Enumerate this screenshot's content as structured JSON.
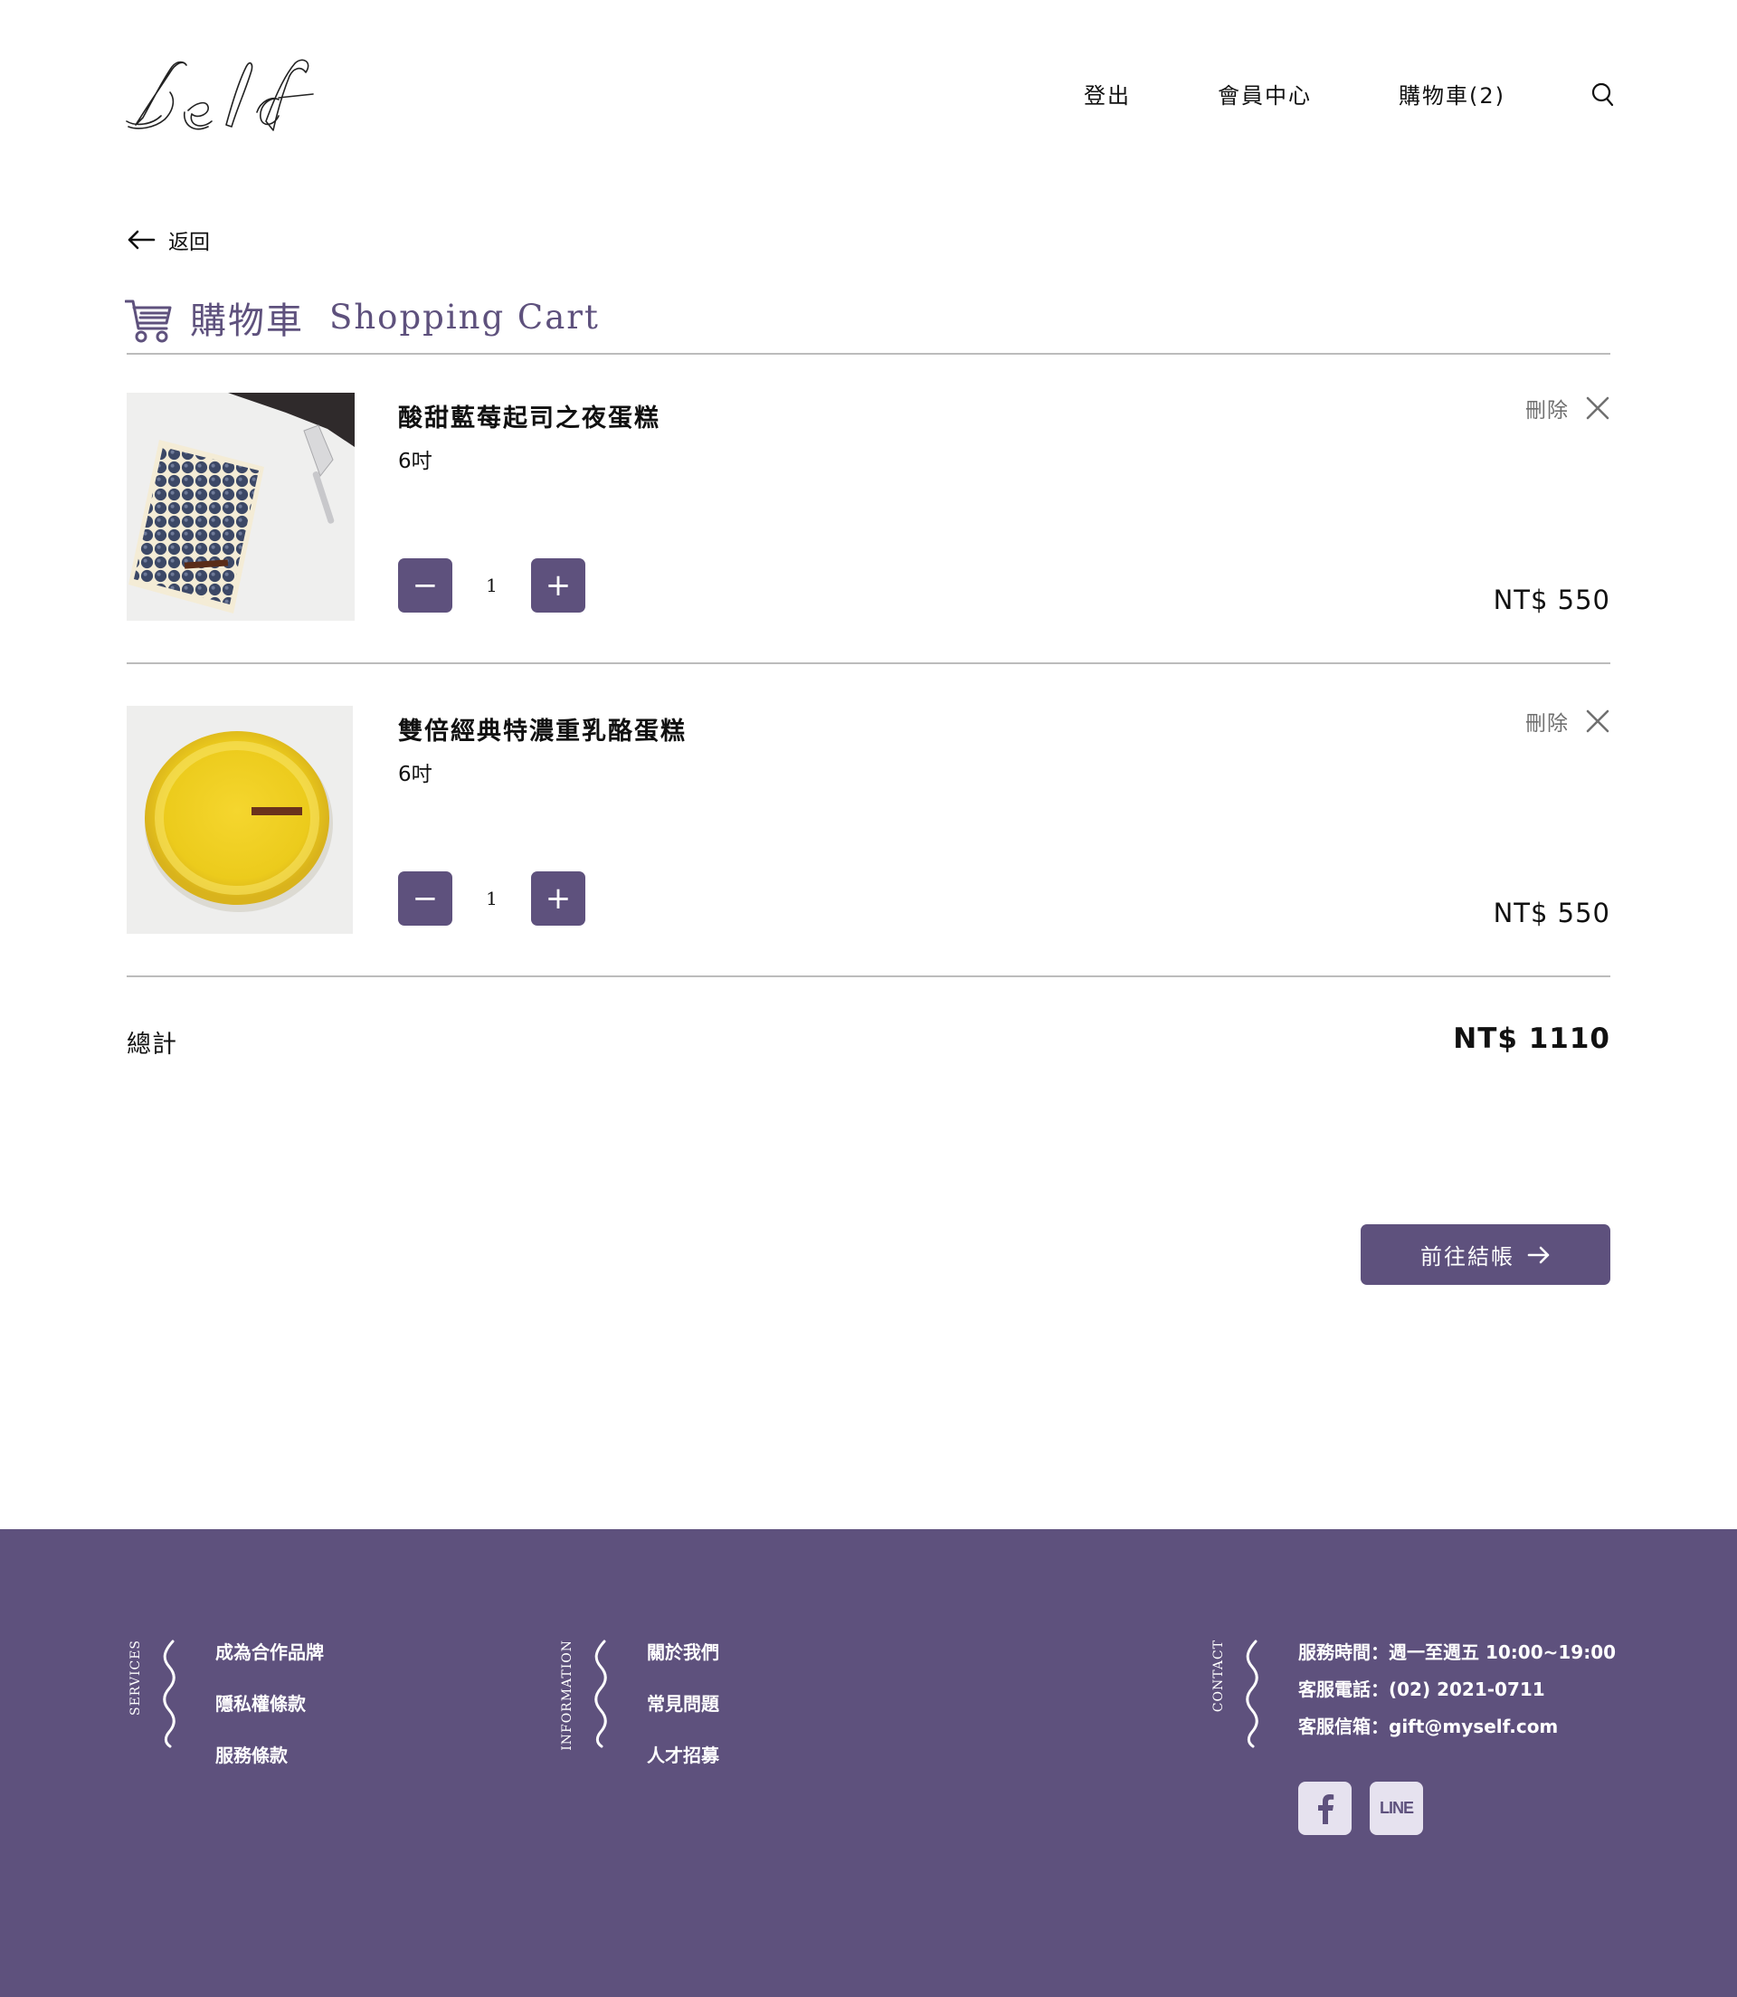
{
  "header": {
    "nav": {
      "logout": "登出",
      "member": "會員中心",
      "cart": "購物車(2)"
    }
  },
  "back": {
    "label": "返回"
  },
  "page": {
    "title_zh": "購物車",
    "title_en": "Shopping Cart"
  },
  "cart": {
    "items": [
      {
        "name": "酸甜藍莓起司之夜蛋糕",
        "spec": "6吋",
        "quantity": "1",
        "price": "NT$ 550",
        "delete_label": "刪除",
        "decrease": "−",
        "increase": "+"
      },
      {
        "name": "雙倍經典特濃重乳酪蛋糕",
        "spec": "6吋",
        "quantity": "1",
        "price": "NT$ 550",
        "delete_label": "刪除",
        "decrease": "−",
        "increase": "+"
      }
    ],
    "total_label": "總計",
    "total_value": "NT$ 1110",
    "checkout_label": "前往結帳"
  },
  "footer": {
    "services": {
      "label": "SERVICES",
      "links": [
        "成為合作品牌",
        "隱私權條款",
        "服務條款"
      ]
    },
    "information": {
      "label": "INFORMATION",
      "links": [
        "關於我們",
        "常見問題",
        "人才招募"
      ]
    },
    "contact": {
      "label": "CONTACT",
      "hours": "服務時間：週一至週五 10:00~19:00",
      "phone": "客服電話：(02) 2021-0711",
      "email": "客服信箱：gift@myself.com",
      "line_text": "LINE"
    }
  },
  "colors": {
    "brand_purple": "#5e517d",
    "social_bg": "#e6e2ef",
    "divider": "#bcbcbc"
  },
  "icons": [
    "self-logo",
    "search-icon",
    "arrow-left-icon",
    "cart-icon",
    "close-icon",
    "arrow-right-icon",
    "wave-icon",
    "facebook-icon",
    "line-icon"
  ]
}
